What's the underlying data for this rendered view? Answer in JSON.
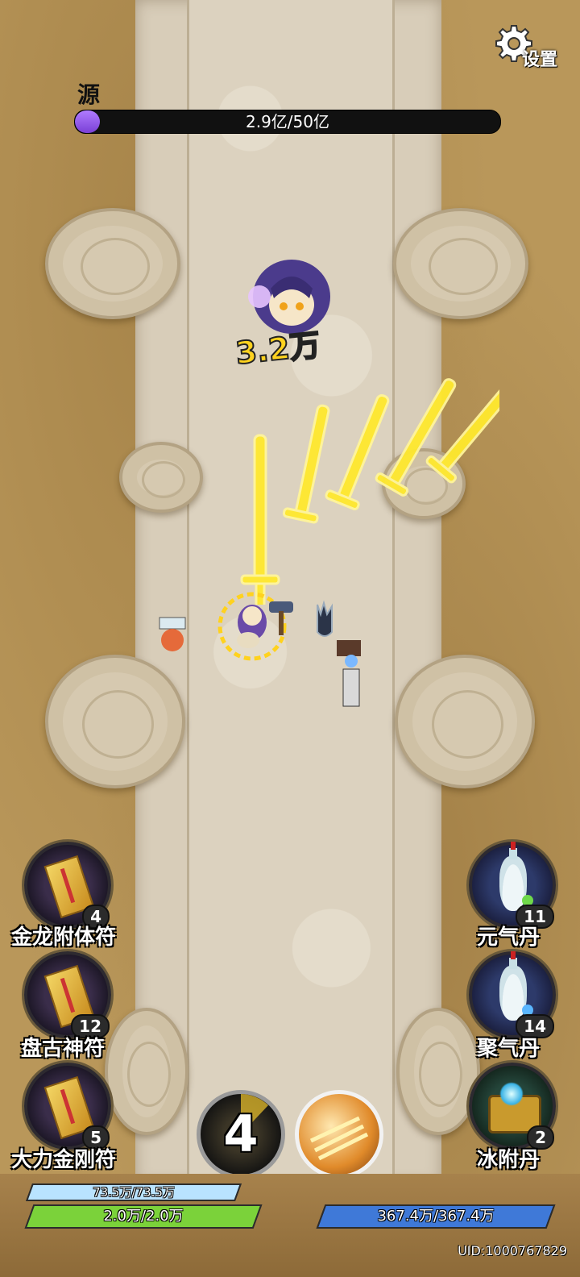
{
  "settings": {
    "label": "设置"
  },
  "boss": {
    "name": "源",
    "hp_text": "2.9亿/50亿",
    "hp_fraction": 0.058
  },
  "combat": {
    "damage_text": "3.2万"
  },
  "items_left": [
    {
      "label": "金龙附体符",
      "count": "4",
      "icon": "talisman-icon"
    },
    {
      "label": "盘古神符",
      "count": "12",
      "icon": "talisman-icon"
    },
    {
      "label": "大力金刚符",
      "count": "5",
      "icon": "talisman-icon"
    }
  ],
  "items_right": [
    {
      "label": "元气丹",
      "count": "11",
      "icon": "vase-icon"
    },
    {
      "label": "聚气丹",
      "count": "14",
      "icon": "vase-icon"
    },
    {
      "label": "冰附丹",
      "count": "2",
      "icon": "chest-icon"
    }
  ],
  "skills": {
    "cooldown_value": "4"
  },
  "stats": {
    "shield_text": "73.5万/73.5万",
    "shield_fraction": 1.0,
    "hp_text": "2.0万/2.0万",
    "hp_fraction": 1.0,
    "mp_text": "367.4万/367.4万",
    "mp_fraction": 1.0
  },
  "uid": "UID:1000767829",
  "colors": {
    "boss_bar": "#8b4fe6",
    "shield": "#b9e3ff",
    "hp": "#7bd23a",
    "mp": "#3f79d8",
    "sword": "#ffe92e"
  }
}
